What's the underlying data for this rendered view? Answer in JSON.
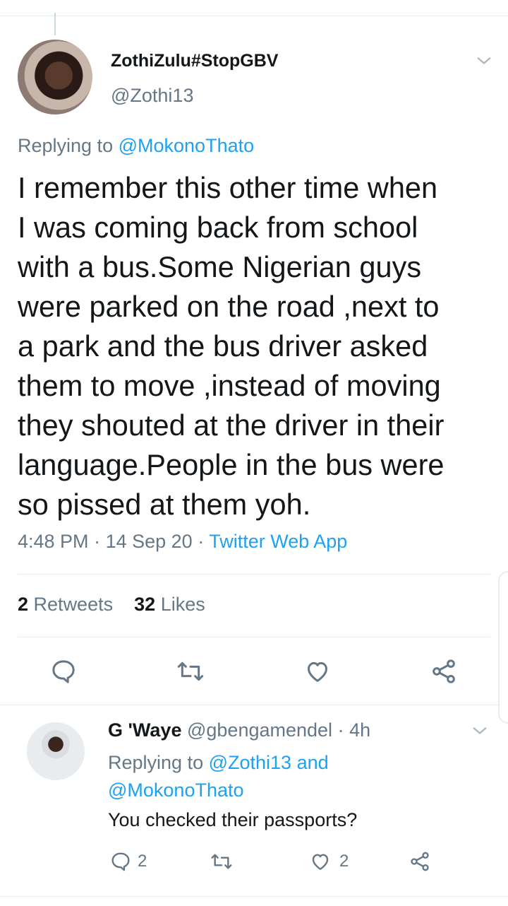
{
  "tweet": {
    "display_name": "ZothiZulu#StopGBV",
    "handle": "@Zothi13",
    "replying_prefix": "Replying to",
    "replying_to": "@MokonoThato",
    "text": "I remember this other time when\nI was coming back from school\nwith a bus.Some Nigerian guys\nwere parked on the road ,next to\na park and the bus driver asked\nthem to move ,instead of moving\nthey shouted at the driver in their\nlanguage.People in the bus were\nso pissed at them yoh.",
    "time": "4:48 PM",
    "date": "14 Sep 20",
    "separator": "·",
    "source": "Twitter Web App",
    "retweet_count": "2",
    "retweet_label": "Retweets",
    "like_count": "32",
    "like_label": "Likes"
  },
  "reply": {
    "display_name": "G 'Waye",
    "handle": "@gbengamendel",
    "separator": "·",
    "age": "4h",
    "replying_prefix": "Replying to",
    "replying_to_1": "@Zothi13",
    "replying_and": "and",
    "replying_to_2": "@MokonoThato",
    "text": "You checked their passports?",
    "reply_count": "2",
    "like_count": "2"
  },
  "icons": {
    "reply": "reply-icon",
    "retweet": "retweet-icon",
    "like": "heart-icon",
    "share": "share-icon",
    "menu": "chevron-down-icon"
  },
  "colors": {
    "link": "#1da1f2",
    "secondary_text": "#657786",
    "primary_text": "#14171a",
    "divider": "#e6ecf0"
  }
}
